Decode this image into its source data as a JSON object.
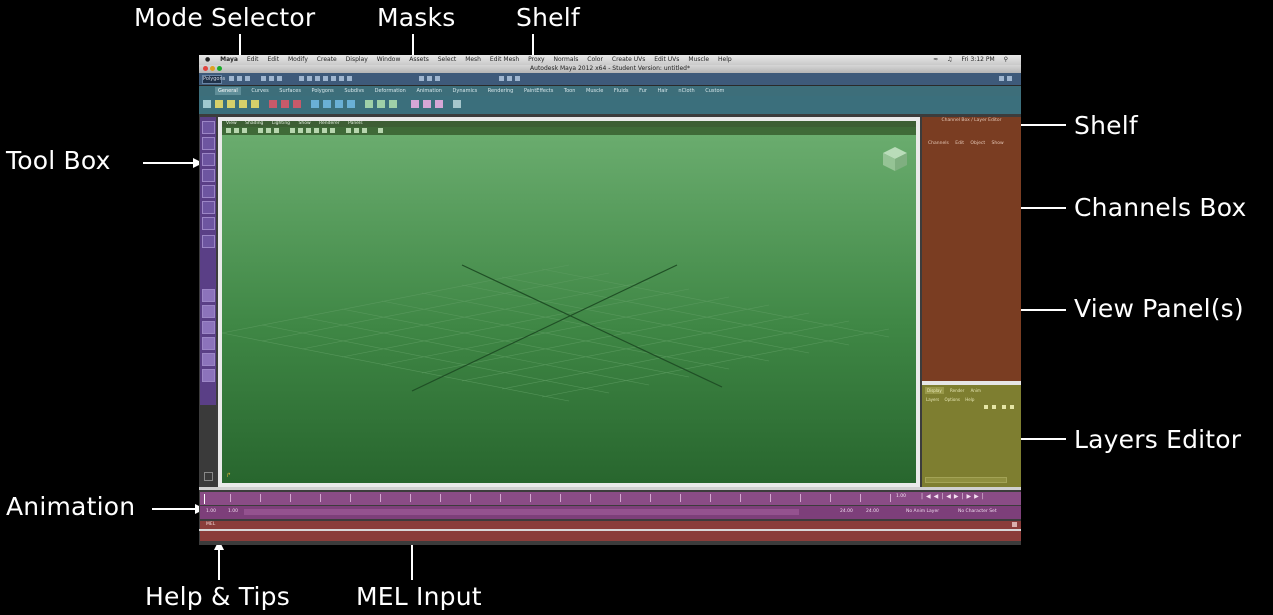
{
  "callouts": {
    "mode_selector": "Mode Selector",
    "masks": "Masks",
    "shelf_top": "Shelf",
    "shelf_right": "Shelf",
    "tool_box": "Tool Box",
    "channels_box": "Channels Box",
    "view_panels": "View Panel(s)",
    "layers_editor": "Layers Editor",
    "animation": "Animation",
    "help_tips": "Help & Tips",
    "mel_input": "MEL Input"
  },
  "menubar": {
    "items": [
      "Maya",
      "Edit",
      "Edit",
      "Modify",
      "Create",
      "Display",
      "Window",
      "Assets",
      "Select",
      "Mesh",
      "Edit Mesh",
      "Proxy",
      "Normals",
      "Color",
      "Create UVs",
      "Edit UVs",
      "Muscle",
      "Help"
    ],
    "clock": "Fri 3:12 PM"
  },
  "titlebar": {
    "title": "Autodesk Maya 2012 x64 - Student Version: untitled*"
  },
  "status_line": {
    "mode": "Polygons"
  },
  "shelf": {
    "tabs": [
      "General",
      "Curves",
      "Surfaces",
      "Polygons",
      "Subdivs",
      "Deformation",
      "Animation",
      "Dynamics",
      "Rendering",
      "PaintEffects",
      "Toon",
      "Muscle",
      "Fluids",
      "Fur",
      "Hair",
      "nCloth",
      "Custom"
    ]
  },
  "view_panel": {
    "menus": [
      "View",
      "Shading",
      "Lighting",
      "Show",
      "Renderer",
      "Panels"
    ]
  },
  "channel_box": {
    "header": "Channel Box / Layer Editor",
    "tabs": [
      "Channels",
      "Edit",
      "Object",
      "Show"
    ]
  },
  "layer_editor": {
    "tabs": [
      "Display",
      "Render",
      "Anim"
    ],
    "menus": [
      "Layers",
      "Options",
      "Help"
    ]
  },
  "time_slider": {
    "start": "1.00",
    "end": "24.00",
    "current": "1.00",
    "range_start": "1.00",
    "range_end": "24.00",
    "anim_layer": "No Anim Layer",
    "character_set": "No Character Set"
  },
  "command_line": {
    "label": "MEL"
  },
  "colors": {
    "toolbox": "#5a3f86",
    "viewport": "#3f8745",
    "channel_box": "#7a3d22",
    "layer_editor": "#7e7e30",
    "time_slider": "#8a4c86",
    "command_line": "#8a3d3a",
    "shelf": "#3b6f7c"
  }
}
